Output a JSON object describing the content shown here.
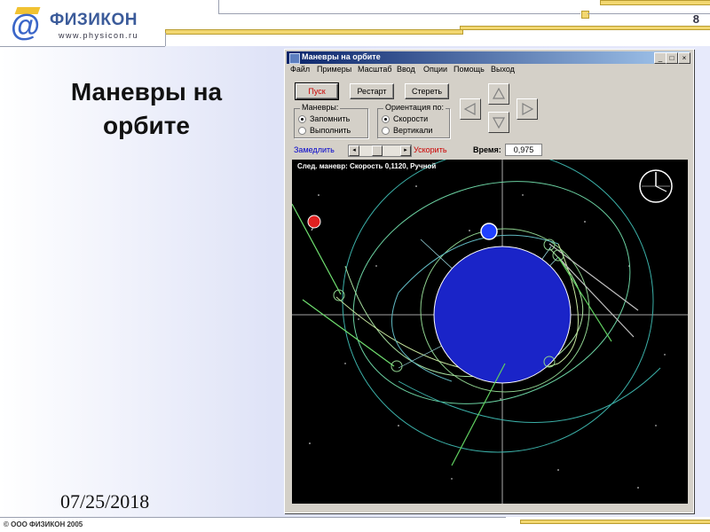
{
  "slide": {
    "logo_symbol": "@",
    "logo_name": "ФИЗИКОН",
    "logo_url": "www.physicon.ru",
    "page_number": "8",
    "title": "Маневры на орбите",
    "date": "07/25/2018",
    "footer": "© ООО ФИЗИКОН 2005"
  },
  "window": {
    "title": "Маневры на орбите",
    "controls": [
      "_",
      "□",
      "×"
    ],
    "menu": [
      "Файл",
      "Примеры",
      "Масштаб",
      "Ввод",
      "Опции",
      "Помощь",
      "Выход"
    ],
    "buttons": {
      "start": "Пуск",
      "restart": "Рестарт",
      "erase": "Стереть"
    },
    "maneuvers_group": {
      "label": "Маневры:",
      "options": [
        "Запомнить",
        "Выполнить"
      ],
      "selected": "Запомнить"
    },
    "orientation_group": {
      "label": "Ориентация по:",
      "options": [
        "Скорости",
        "Вертикали"
      ],
      "selected": "Скорости"
    },
    "direction_icons": [
      "arrow-left-icon",
      "arrow-up-icon",
      "arrow-down-icon",
      "arrow-right-icon"
    ],
    "slow_label": "Замедлить",
    "fast_label": "Ускорить",
    "time_label": "Время:",
    "time_value": "0,975",
    "canvas_info": "След. маневр:  Скорость  0,1120,  Ручной",
    "colors": {
      "canvas_bg": "#000000",
      "planet": "#1a24c8",
      "orbit": "#8fd28f",
      "guide": "#9fe0e8",
      "satellite_red": "#e02020",
      "satellite_blue": "#2040ff",
      "accent_red": "#cc0000",
      "accent_blue": "#0000cc"
    }
  }
}
